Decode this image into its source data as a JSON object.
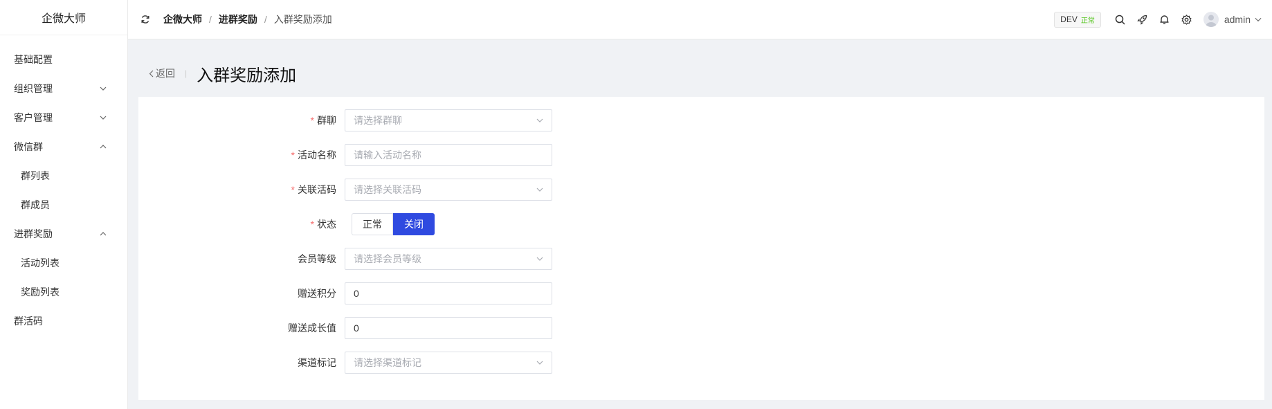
{
  "app": {
    "title": "企微大师"
  },
  "sidebar": {
    "items": [
      {
        "label": "基础配置"
      },
      {
        "label": "组织管理"
      },
      {
        "label": "客户管理"
      },
      {
        "label": "微信群"
      },
      {
        "label": "群列表"
      },
      {
        "label": "群成员"
      },
      {
        "label": "进群奖励"
      },
      {
        "label": "活动列表"
      },
      {
        "label": "奖励列表"
      },
      {
        "label": "群活码"
      }
    ]
  },
  "header": {
    "breadcrumb": [
      "企微大师",
      "进群奖励",
      "入群奖励添加"
    ],
    "separator": "/",
    "env": {
      "name": "DEV",
      "status": "正常"
    },
    "user": "admin"
  },
  "page": {
    "back_label": "返回",
    "sep": "|",
    "title": "入群奖励添加"
  },
  "form": {
    "required_mark": "*",
    "group": {
      "label": "群聊",
      "placeholder": "请选择群聊"
    },
    "activity_name": {
      "label": "活动名称",
      "placeholder": "请输入活动名称"
    },
    "live_code": {
      "label": "关联活码",
      "placeholder": "请选择关联活码"
    },
    "status": {
      "label": "状态",
      "options": [
        "正常",
        "关闭"
      ],
      "selected": "关闭"
    },
    "member_level": {
      "label": "会员等级",
      "placeholder": "请选择会员等级"
    },
    "points": {
      "label": "赠送积分",
      "value": "0"
    },
    "growth": {
      "label": "赠送成长值",
      "value": "0"
    },
    "channel": {
      "label": "渠道标记",
      "placeholder": "请选择渠道标记"
    }
  },
  "colors": {
    "primary": "#2f4ae0",
    "required": "#f56c6c",
    "env_ok": "#52c41a"
  }
}
